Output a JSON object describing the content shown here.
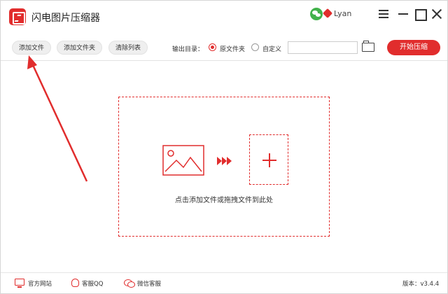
{
  "app": {
    "title": "闪电图片压缩器"
  },
  "user": {
    "name": "Lyan"
  },
  "toolbar": {
    "add_file": "添加文件",
    "add_folder": "添加文件夹",
    "clear_list": "清除列表",
    "output_label": "输出目录：",
    "option_original": "原文件夹",
    "option_custom": "自定义",
    "selected_option": "原文件夹",
    "path_value": "",
    "start": "开始压缩"
  },
  "dropzone": {
    "hint": "点击添加文件或拖拽文件到此处"
  },
  "footer": {
    "website": "官方网站",
    "qq_service": "客服QQ",
    "wechat_service": "微信客服",
    "version": "版本：v3.4.4"
  },
  "colors": {
    "accent": "#e12d2d",
    "wechat": "#42b24b"
  },
  "icons": [
    "app-logo-icon",
    "wechat-icon",
    "vip-icon",
    "menu-icon",
    "minimize-icon",
    "maximize-icon",
    "close-icon",
    "folder-icon",
    "image-icon",
    "arrows-icon",
    "plus-icon",
    "monitor-icon",
    "qq-icon",
    "chat-icon"
  ]
}
